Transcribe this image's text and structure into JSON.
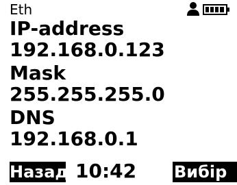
{
  "header": {
    "title": "Eth",
    "icons": [
      "user-icon",
      "battery-icon"
    ]
  },
  "network": {
    "ip_label": "IP-address",
    "ip_value": "192.168.0.123",
    "mask_label": "Mask",
    "mask_value": "255.255.255.0",
    "dns_label": "DNS",
    "dns_value": "192.168.0.1"
  },
  "footer": {
    "back_label": "Назад",
    "time": "10:42",
    "select_label": "Вибір"
  },
  "colors": {
    "background": "#ffffff",
    "foreground": "#000000",
    "softkey_background": "#000000",
    "softkey_text": "#ffffff"
  }
}
